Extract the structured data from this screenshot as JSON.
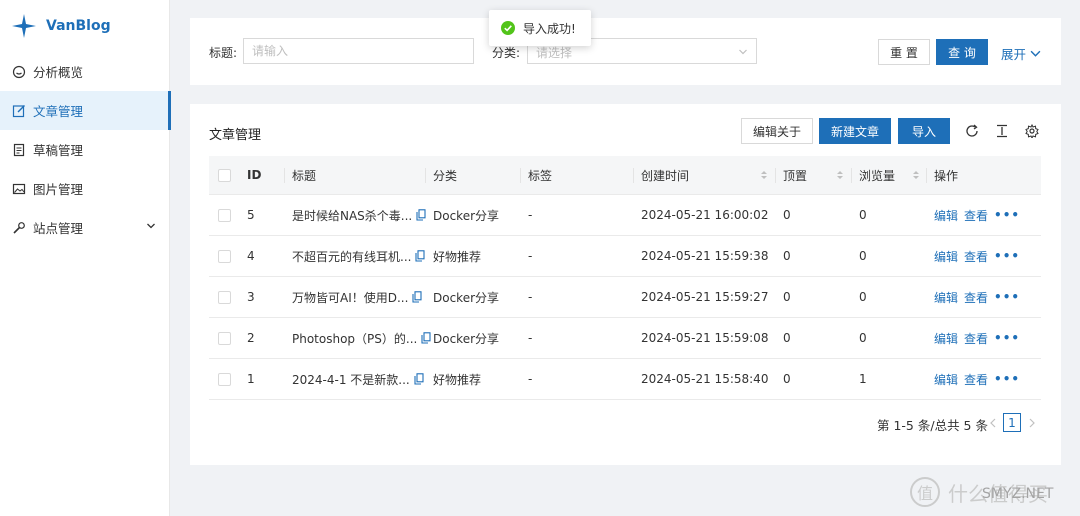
{
  "app": {
    "brand": "VanBlog"
  },
  "sidebar": {
    "items": [
      {
        "label": "分析概览",
        "icon": "dashboard-icon"
      },
      {
        "label": "文章管理",
        "icon": "edit-icon",
        "active": true
      },
      {
        "label": "草稿管理",
        "icon": "draft-icon"
      },
      {
        "label": "图片管理",
        "icon": "image-icon"
      },
      {
        "label": "站点管理",
        "icon": "tool-icon",
        "expandable": true
      }
    ]
  },
  "search": {
    "title_label": "标题:",
    "title_placeholder": "请输入",
    "category_label": "分类:",
    "category_placeholder": "请选择",
    "reset_label": "重 置",
    "query_label": "查 询",
    "expand_label": "展开"
  },
  "toast": {
    "text": "导入成功!",
    "icon": "check-circle-icon"
  },
  "table": {
    "title": "文章管理",
    "toolbar": {
      "edit_about": "编辑关于",
      "new_article": "新建文章",
      "import": "导入"
    },
    "columns": [
      "ID",
      "标题",
      "分类",
      "标签",
      "创建时间",
      "顶置",
      "浏览量",
      "操作"
    ],
    "rows": [
      {
        "id": "5",
        "title": "是时候给NAS杀个毒...",
        "category": "Docker分享",
        "tags": "-",
        "created": "2024-05-21 16:00:02",
        "pinned": "0",
        "views": "0"
      },
      {
        "id": "4",
        "title": "不超百元的有线耳机...",
        "category": "好物推荐",
        "tags": "-",
        "created": "2024-05-21 15:59:38",
        "pinned": "0",
        "views": "0"
      },
      {
        "id": "3",
        "title": "万物皆可AI！使用D...",
        "category": "Docker分享",
        "tags": "-",
        "created": "2024-05-21 15:59:27",
        "pinned": "0",
        "views": "0"
      },
      {
        "id": "2",
        "title": "Photoshop（PS）的...",
        "category": "Docker分享",
        "tags": "-",
        "created": "2024-05-21 15:59:08",
        "pinned": "0",
        "views": "0"
      },
      {
        "id": "1",
        "title": "2024-4-1 不是新款...",
        "category": "好物推荐",
        "tags": "-",
        "created": "2024-05-21 15:58:40",
        "pinned": "0",
        "views": "1"
      }
    ],
    "actions": {
      "edit": "编辑",
      "view": "查看",
      "more": "•••"
    },
    "pagination": {
      "summary": "第 1-5 条/总共 5 条",
      "current_page": "1"
    }
  },
  "watermark": {
    "logo": "值",
    "text": "什么值得买",
    "sub": "SMYZ.NET"
  },
  "colors": {
    "accent": "#1e6fb8",
    "success": "#52c41a",
    "active_bg": "#e6f2fb"
  }
}
